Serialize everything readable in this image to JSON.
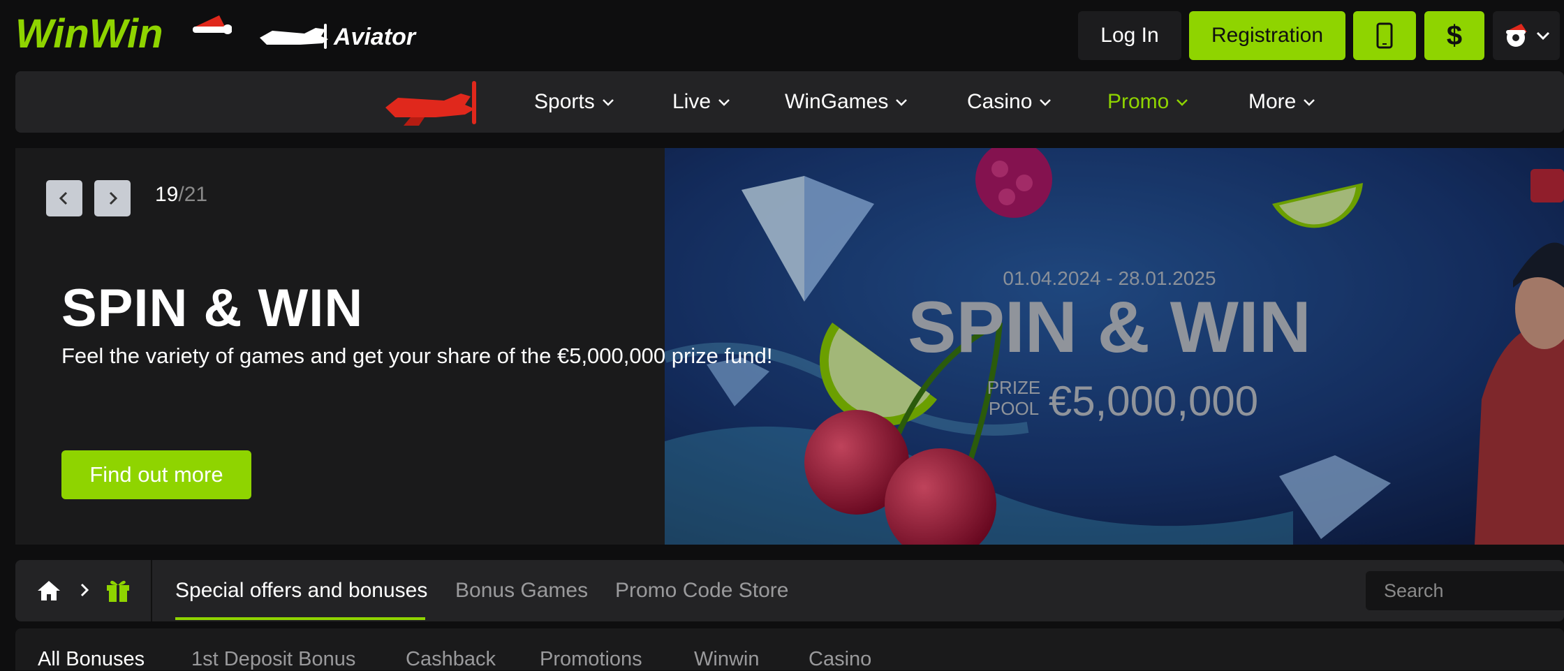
{
  "header": {
    "brand": "WinWin",
    "partner": "Aviator",
    "login_label": "Log In",
    "register_label": "Registration",
    "mobile_icon": "mobile-phone-icon",
    "currency_symbol": "$",
    "settings_icon": "gear-icon"
  },
  "nav": {
    "items": [
      {
        "label": "Sports"
      },
      {
        "label": "Live"
      },
      {
        "label": "WinGames"
      },
      {
        "label": "Casino"
      },
      {
        "label": "Promo",
        "active": true
      },
      {
        "label": "More"
      }
    ]
  },
  "hero": {
    "current": "19",
    "total": "/21",
    "title": "SPIN & WIN",
    "subtitle": "Feel the variety of games and get your share of the €5,000,000 prize fund!",
    "cta": "Find out more",
    "banner": {
      "dates": "01.04.2024 - 28.01.2025",
      "title": "SPIN & WIN",
      "prize_label_1": "PRIZE",
      "prize_label_2": "POOL",
      "prize_amount": "€5,000,000"
    }
  },
  "subnav": {
    "tabs": [
      {
        "label": "Special offers and bonuses",
        "active": true
      },
      {
        "label": "Bonus Games"
      },
      {
        "label": "Promo Code Store"
      }
    ],
    "search_placeholder": "Search"
  },
  "filters": [
    {
      "label": "All Bonuses",
      "active": true
    },
    {
      "label": "1st Deposit Bonus"
    },
    {
      "label": "Cashback"
    },
    {
      "label": "Promotions"
    },
    {
      "label": "Winwin"
    },
    {
      "label": "Casino"
    }
  ],
  "colors": {
    "accent": "#8fd400",
    "background": "#0e0e0f",
    "panel": "#232325",
    "plane_red": "#e0281c"
  }
}
